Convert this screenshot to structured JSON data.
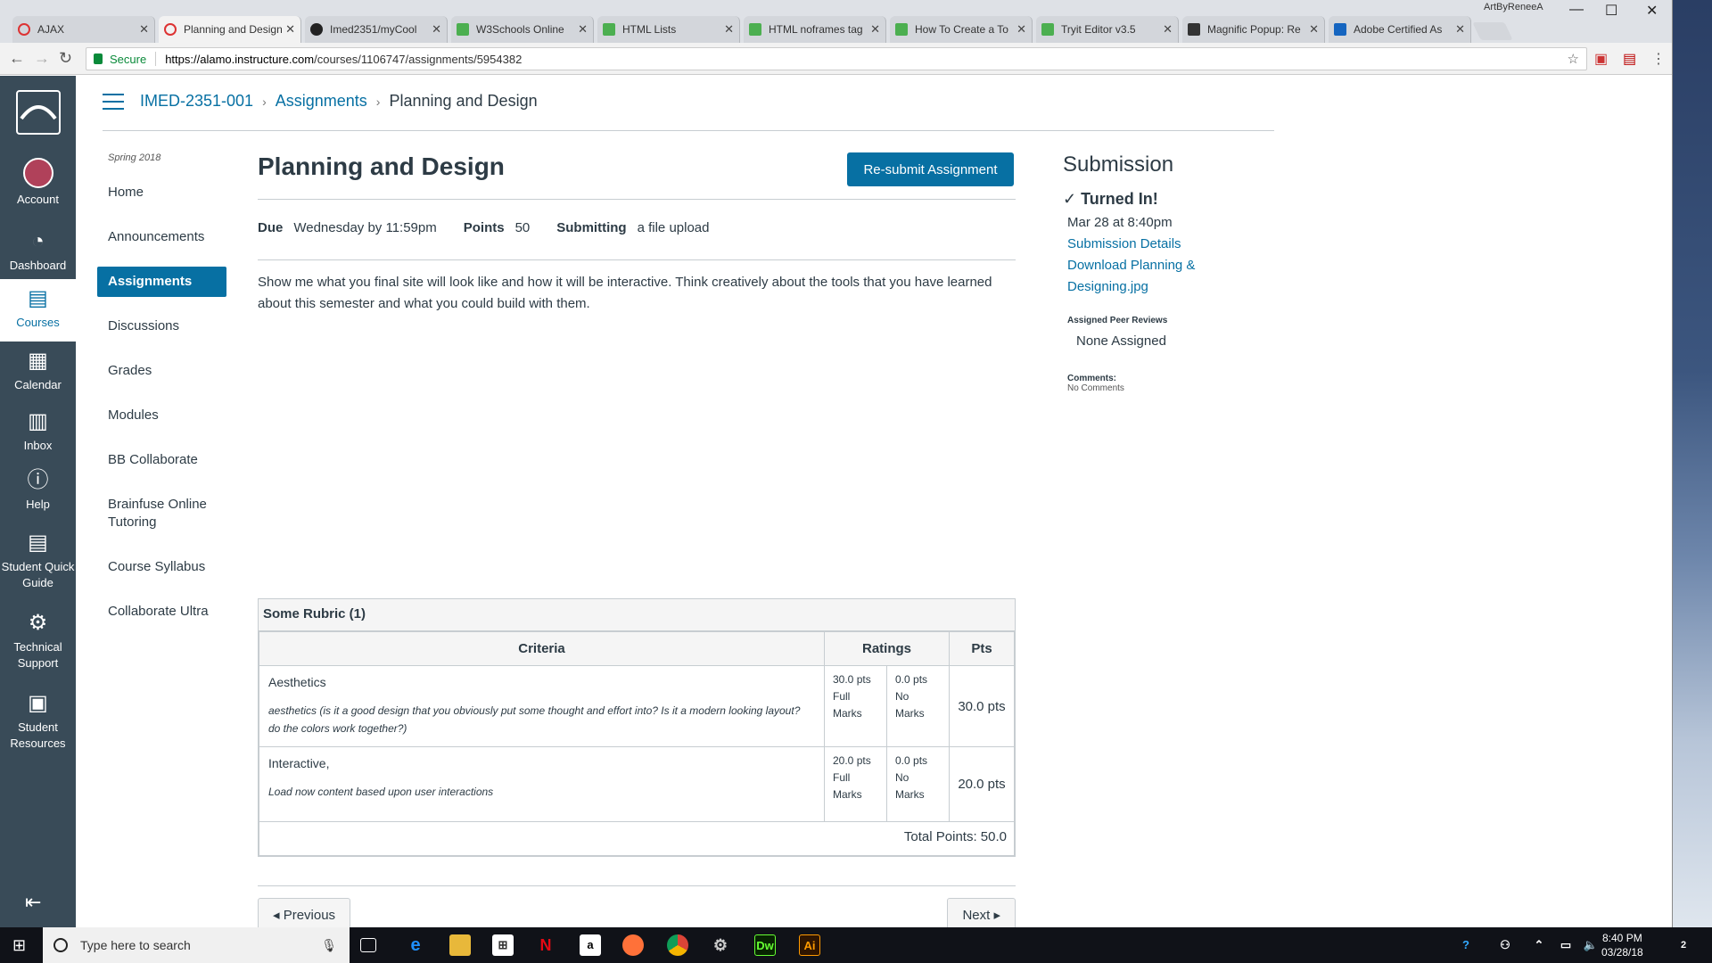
{
  "browser": {
    "tabs": [
      {
        "title": "AJAX",
        "icon": "ring"
      },
      {
        "title": "Planning and Design",
        "icon": "ring"
      },
      {
        "title": "Imed2351/myCool",
        "icon": "gh"
      },
      {
        "title": "W3Schools Online",
        "icon": "w3"
      },
      {
        "title": "HTML Lists",
        "icon": "w3"
      },
      {
        "title": "HTML noframes tag",
        "icon": "w3"
      },
      {
        "title": "How To Create a To",
        "icon": "w3"
      },
      {
        "title": "Tryit Editor v3.5",
        "icon": "w3"
      },
      {
        "title": "Magnific Popup: Re",
        "icon": "mp"
      },
      {
        "title": "Adobe Certified As",
        "icon": "ad"
      }
    ],
    "user": "ArtByReneeA",
    "secure_label": "Secure",
    "url_host": "https://alamo.instructure.com",
    "url_path": "/courses/1106747/assignments/5954382"
  },
  "global_nav": {
    "account": "Account",
    "dashboard": "Dashboard",
    "courses": "Courses",
    "calendar": "Calendar",
    "inbox": "Inbox",
    "help": "Help",
    "quick_guide": "Student Quick Guide",
    "tech_support": "Technical Support",
    "resources": "Student Resources"
  },
  "breadcrumb": {
    "course": "IMED-2351-001",
    "section": "Assignments",
    "page": "Planning and Design"
  },
  "course_nav": {
    "term": "Spring 2018",
    "items": [
      "Home",
      "Announcements",
      "Assignments",
      "Discussions",
      "Grades",
      "Modules",
      "BB Collaborate",
      "Brainfuse Online Tutoring",
      "Course Syllabus",
      "Collaborate Ultra"
    ]
  },
  "assignment": {
    "title": "Planning and Design",
    "resubmit": "Re-submit Assignment",
    "due_label": "Due",
    "due": "Wednesday by 11:59pm",
    "points_label": "Points",
    "points": "50",
    "submitting_label": "Submitting",
    "submitting": "a file upload",
    "description": "Show me what you final site will look like and how it will be interactive.  Think creatively about the tools that you have learned about this semester and what you could build with them."
  },
  "rubric": {
    "caption": "Some Rubric (1)",
    "headers": [
      "Criteria",
      "Ratings",
      "Pts"
    ],
    "rows": [
      {
        "name": "Aesthetics",
        "desc": "aesthetics (is it a good design that you obviously put some thought and effort into? Is it a modern looking layout? do the colors work together?)",
        "r1": "30.0 pts",
        "r1l": "Full Marks",
        "r2": "0.0 pts",
        "r2l": "No Marks",
        "pts": "30.0 pts"
      },
      {
        "name": "Interactive,",
        "desc": "Load now content based upon user interactions",
        "r1": "20.0 pts",
        "r1l": "Full Marks",
        "r2": "0.0 pts",
        "r2l": "No Marks",
        "pts": "20.0 pts"
      }
    ],
    "total": "Total Points: 50.0"
  },
  "pager": {
    "prev": "◂ Previous",
    "next": "Next ▸"
  },
  "submission": {
    "heading": "Submission",
    "status": "Turned In!",
    "date": "Mar 28 at 8:40pm",
    "details": "Submission Details",
    "download": "Download Planning & Designing.jpg",
    "peer_label": "Assigned Peer Reviews",
    "peer": "None Assigned",
    "comments_label": "Comments:",
    "comments": "No Comments"
  },
  "taskbar": {
    "search": "Type here to search",
    "time": "8:40 PM",
    "date": "03/28/18",
    "notif": "2"
  }
}
